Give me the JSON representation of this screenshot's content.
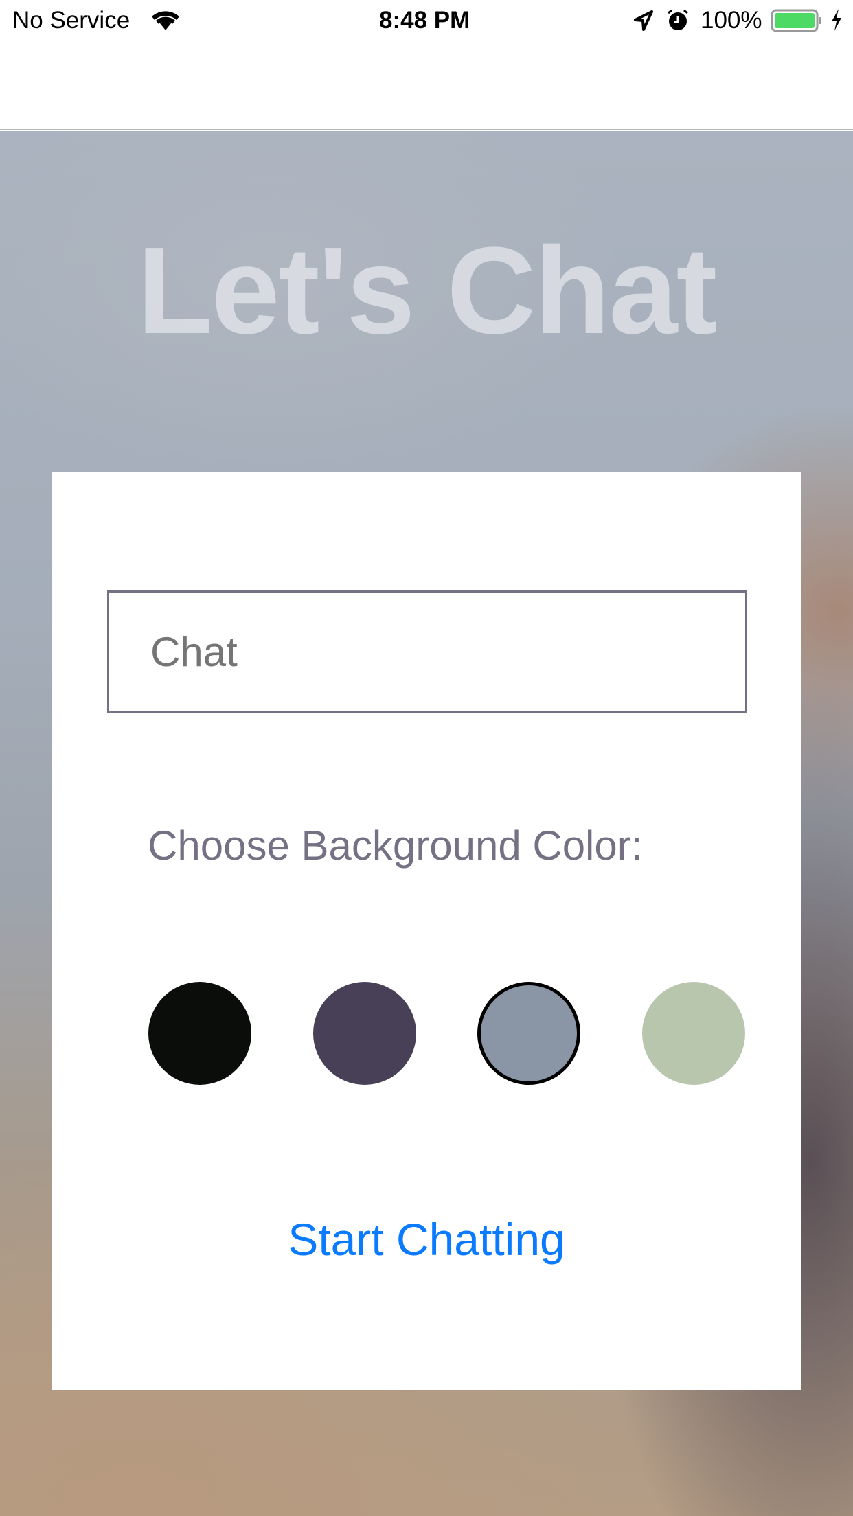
{
  "status_bar": {
    "carrier": "No Service",
    "time": "8:48 PM",
    "battery": "100%",
    "battery_level": 1.0
  },
  "title": "Let's Chat",
  "form": {
    "name_input_placeholder": "Chat",
    "color_label": "Choose Background Color:",
    "colors": [
      "#0b0d0a",
      "#474056",
      "#8a95a5",
      "#b9c6ae"
    ],
    "selected_color_index": 2,
    "start_button": "Start Chatting"
  },
  "accent_color": "#0a7aff"
}
